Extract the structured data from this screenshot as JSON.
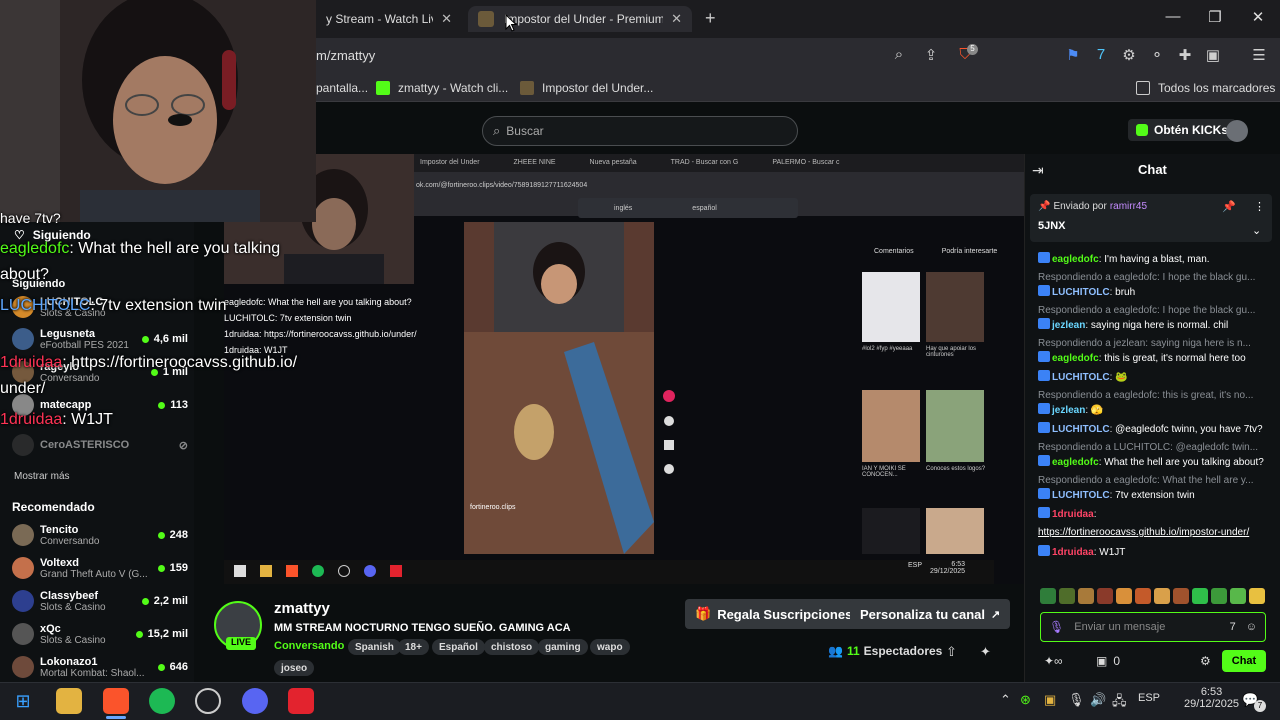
{
  "browser": {
    "tabs": [
      {
        "title": "y Stream - Watch Live o",
        "active": false
      },
      {
        "title": "Impostor del Under - Premium B",
        "active": true
      }
    ],
    "url": "m/zmattyy",
    "bookmarks": [
      {
        "label": "pantalla..."
      },
      {
        "label": "zmattyy - Watch cli..."
      },
      {
        "label": "Impostor del Under..."
      }
    ],
    "all_bookmarks": "Todos los marcadores",
    "brave_badge": "5"
  },
  "header": {
    "search_placeholder": "Buscar",
    "kicks_button": "Obtén KICKs"
  },
  "sidebar": {
    "following_label": "Siguiendo",
    "following": [
      {
        "name": "LUCHITOLC",
        "category": "Slots & Casino",
        "viewers": ""
      },
      {
        "name": "Legusneta",
        "category": "eFootball PES 2021",
        "viewers": "4,6 mil"
      },
      {
        "name": "rageylo",
        "category": "Conversando",
        "viewers": "1 mil"
      },
      {
        "name": "matecapp",
        "category": "",
        "viewers": "113"
      },
      {
        "name": "CeroASTERISCO",
        "category": "",
        "viewers": ""
      }
    ],
    "show_more": "Mostrar más",
    "recommended_label": "Recomendado",
    "recommended": [
      {
        "name": "Tencito",
        "category": "Conversando",
        "viewers": "248"
      },
      {
        "name": "Voltexd",
        "category": "Grand Theft Auto V (G...",
        "viewers": "159"
      },
      {
        "name": "Classybeef",
        "category": "Slots & Casino",
        "viewers": "2,2 mil"
      },
      {
        "name": "xQc",
        "category": "Slots & Casino",
        "viewers": "15,2 mil"
      },
      {
        "name": "Lokonazo1",
        "category": "Mortal Kombat: Shaol...",
        "viewers": "646"
      }
    ]
  },
  "overlay_chat": [
    {
      "user": "",
      "text": "have 7tv?"
    },
    {
      "user": "",
      "text": "Siguiendo"
    },
    {
      "user": "eagledofc",
      "text": ": What the hell are you talking"
    },
    {
      "user": "",
      "text": "about?"
    },
    {
      "user": "LUCHITOLC",
      "text": ": 7tv extension twin"
    },
    {
      "user": "1druidaa",
      "text": ": https://fortineroocavss.github.io/"
    },
    {
      "user": "",
      "text": "under/"
    },
    {
      "user": "1druidaa",
      "text": ": W1JT"
    }
  ],
  "video": {
    "inner_tabs": [
      "Impostor del Under",
      "ZHEEE NINE",
      "Nueva pestaña",
      "TRAD - Buscar con G",
      "PALERMO - Buscar c"
    ],
    "inner_url": "ok.com/@fortineroo.clips/video/7589189127711624504",
    "translate_tabs": [
      "inglés",
      "español"
    ],
    "inner_chat": [
      "eagledofc: What the hell are you talking about?",
      "LUCHITOLC: 7tv extension twin",
      "1druidaa: https://fortineroocavss.github.io/under/",
      "1druidaa: W1JT"
    ],
    "side_tabs": [
      "Comentarios",
      "Podría interesarte"
    ],
    "thumbs": [
      {
        "caption": "#lol2 #fyp #yeeaaa"
      },
      {
        "caption": "Hay que apoiar los cinturones"
      },
      {
        "caption": "IAN Y MOIKI SE CONOCEN..."
      },
      {
        "caption": "Conoces estos logos?"
      }
    ],
    "caption_user": "fortineroo.clips",
    "clock": "6:53",
    "date": "29/12/2025",
    "lang": "ESP"
  },
  "stream": {
    "streamer": "zmattyy",
    "live_badge": "LIVE",
    "title": "MM STREAM NOCTURNO TENGO SUEÑO. GAMING ACA",
    "category": "Conversando",
    "tags": [
      "Spanish",
      "18+",
      "Español",
      "chistoso",
      "gaming",
      "wapo",
      "joseo"
    ],
    "gift_button": "Regala Suscripciones",
    "customize_button": "Personaliza tu canal",
    "viewers": "11",
    "viewers_label": "Espectadores"
  },
  "chat": {
    "title": "Chat",
    "pinned_by_label": "Enviado por",
    "pinned_by": "ramirr45",
    "pinned_text": "5JNX",
    "messages": [
      {
        "reply": "",
        "user": "eagledofc",
        "color": "g",
        "text": "I'm having a blast, man."
      },
      {
        "reply": "Respondiendo a eagledofc: I hope the black gu...",
        "user": "LUCHITOLC",
        "color": "b",
        "text": "bruh"
      },
      {
        "reply": "Respondiendo a eagledofc: I hope the black gu...",
        "user": "jezlean",
        "color": "t",
        "text": "saying niga here is normal. chil"
      },
      {
        "reply": "Respondiendo a jezlean: saying niga here is n...",
        "user": "eagledofc",
        "color": "g",
        "text": "this is great, it's normal here too"
      },
      {
        "reply": "",
        "user": "LUCHITOLC",
        "color": "b",
        "text": "🐸"
      },
      {
        "reply": "Respondiendo a eagledofc: this is great, it's no...",
        "user": "jezlean",
        "color": "t",
        "text": "🫣"
      },
      {
        "reply": "",
        "user": "LUCHITOLC",
        "color": "b",
        "text": "@eagledofc twinn, you have 7tv?"
      },
      {
        "reply": "Respondiendo a LUCHITOLC: @eagledofc twin...",
        "user": "eagledofc",
        "color": "g",
        "text": "What the hell are you talking about?"
      },
      {
        "reply": "Respondiendo a eagledofc: What the hell are y...",
        "user": "LUCHITOLC",
        "color": "b",
        "text": "7tv extension twin"
      },
      {
        "reply": "",
        "user": "1druidaa",
        "color": "r",
        "text": ""
      },
      {
        "reply": "",
        "user": "",
        "color": "",
        "text": "https://fortineroocavss.github.io/impostor-under/"
      },
      {
        "reply": "",
        "user": "1druidaa",
        "color": "r",
        "text": "W1JT"
      }
    ],
    "input_placeholder": "Enviar un mensaje",
    "points": "0",
    "send_button": "Chat"
  },
  "taskbar": {
    "clock": "6:53",
    "date": "29/12/2025",
    "lang": "ESP",
    "notif_count": "7"
  },
  "colors": {
    "kick_green": "#53fc18",
    "bg": "#0b0e0f",
    "live_red": "#ff3355"
  }
}
